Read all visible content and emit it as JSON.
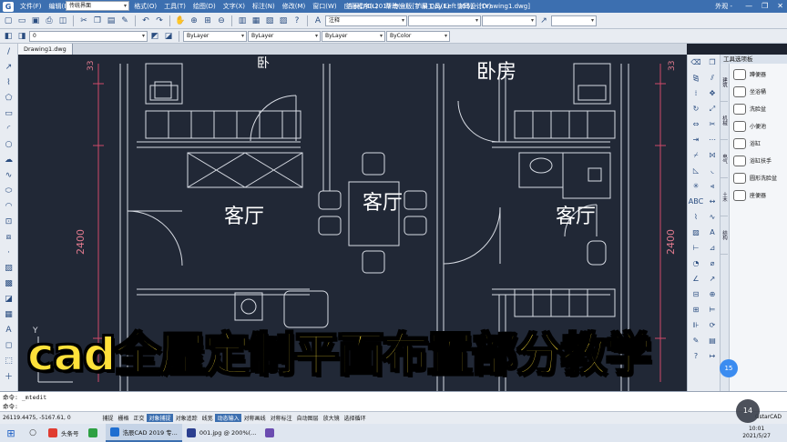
{
  "app": {
    "title": "浩辰CAD 2019 专业版[Trial Day Left 355] - [Drawing1.dwg]",
    "logo_letter": "G",
    "workspace": "传统界面",
    "user": "外观 -",
    "menu": [
      "文件(F)",
      "编辑(E)",
      "视图(V)",
      "插入(I)",
      "格式(O)",
      "工具(T)",
      "绘图(D)",
      "文字(X)",
      "标注(N)",
      "修改(M)",
      "窗口(W)",
      "应用程序(L)",
      "帮助(H)",
      "扩展工具(E)",
      "协同设计(Y)"
    ],
    "window_controls": [
      "—",
      "❐",
      "✕"
    ]
  },
  "toolbar2": {
    "layer": "0",
    "color": "ByLayer",
    "linetype": "ByLayer",
    "lineweight": "ByLayer",
    "plotstyle": "ByColor",
    "text_style": "注释"
  },
  "document_tab": "Drawing1.dwg",
  "drawing": {
    "room_labels": [
      "客厅",
      "客厅",
      "客厅",
      "卧房"
    ],
    "top_partial_label": "卧",
    "dimension": "2400",
    "dimension_small": "33",
    "axis_label": "Y"
  },
  "palette": {
    "title": "工具选项板",
    "tabs": [
      "建筑",
      "机械",
      "电气",
      "土木",
      "结构"
    ],
    "items": [
      "蹲便器",
      "坐浴桶",
      "洗脸盆",
      "小便池",
      "浴缸",
      "浴缸扶手",
      "圆形洗脸盆",
      "座便器"
    ]
  },
  "command": {
    "line1": "命令: _mtedit",
    "line2": "命令:"
  },
  "status": {
    "coords": "26119.4475, -5167.61, 0",
    "toggles": [
      "捕捉",
      "栅格",
      "正交",
      "对象捕捉",
      "对象追踪",
      "线宽",
      "动态输入",
      "对称画线",
      "对称标注",
      "自动图层",
      "放大镜"
    ],
    "active_toggles": [
      "对象捕捉",
      "动态输入"
    ],
    "right": "选择循环",
    "brand": "GstarCAD"
  },
  "taskbar": {
    "apps": [
      {
        "label": "头条号",
        "color": "#e03c31"
      },
      {
        "label": "",
        "color": "#2ea043"
      },
      {
        "label": "浩辰CAD 2019 专...",
        "color": "#1f6fd1",
        "active": true
      },
      {
        "label": "001.jpg @ 200%(...",
        "color": "#2b3f8f"
      },
      {
        "label": "",
        "color": "#6b4cb0"
      }
    ],
    "time": "10:01",
    "date": "2021/5/27"
  },
  "overlay": {
    "banner": "cad全屋定制平面布置部分教学",
    "zoom": "14",
    "badge": "15"
  }
}
